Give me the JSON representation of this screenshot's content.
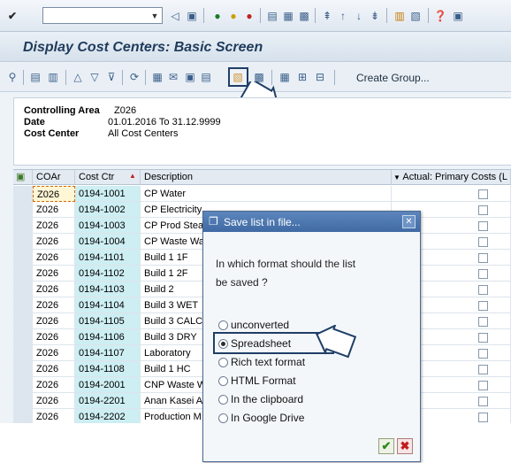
{
  "title": "Display Cost Centers: Basic Screen",
  "toolbar": {
    "command_value": "",
    "icons": [
      "check-icon",
      "back-icon",
      "save-icon",
      "back-nav-icon",
      "exit-icon",
      "cancel-icon",
      "print-icon",
      "find-icon",
      "find-next-icon",
      "first-page-icon",
      "prev-page-icon",
      "next-page-icon",
      "last-page-icon",
      "layout-icon",
      "config-icon",
      "help-icon",
      "settings-icon"
    ]
  },
  "app_toolbar": {
    "create_group_label": "Create Group..."
  },
  "header": {
    "controlling_area_label": "Controlling Area",
    "controlling_area_value": "Z026",
    "date_label": "Date",
    "date_value": "01.01.2016 To 31.12.9999",
    "cost_center_label": "Cost Center",
    "cost_center_value": "All Cost Centers"
  },
  "grid": {
    "columns": [
      "COAr",
      "Cost Ctr",
      "Description",
      "Actual: Primary Costs (L"
    ],
    "rows": [
      {
        "coar": "Z026",
        "cc": "0194-1001",
        "desc": "CP Water"
      },
      {
        "coar": "Z026",
        "cc": "0194-1002",
        "desc": "CP Electricity"
      },
      {
        "coar": "Z026",
        "cc": "0194-1003",
        "desc": "CP Prod Stea"
      },
      {
        "coar": "Z026",
        "cc": "0194-1004",
        "desc": "CP Waste Wa"
      },
      {
        "coar": "Z026",
        "cc": "0194-1101",
        "desc": "Build 1 1F"
      },
      {
        "coar": "Z026",
        "cc": "0194-1102",
        "desc": "Build 1 2F"
      },
      {
        "coar": "Z026",
        "cc": "0194-1103",
        "desc": "Build 2"
      },
      {
        "coar": "Z026",
        "cc": "0194-1104",
        "desc": "Build 3 WET"
      },
      {
        "coar": "Z026",
        "cc": "0194-1105",
        "desc": "Build 3 CALCI"
      },
      {
        "coar": "Z026",
        "cc": "0194-1106",
        "desc": "Build 3 DRY"
      },
      {
        "coar": "Z026",
        "cc": "0194-1107",
        "desc": "Laboratory"
      },
      {
        "coar": "Z026",
        "cc": "0194-1108",
        "desc": "Build 1 HC"
      },
      {
        "coar": "Z026",
        "cc": "0194-2001",
        "desc": "CNP Waste W"
      },
      {
        "coar": "Z026",
        "cc": "0194-2201",
        "desc": "Anan Kasei A"
      },
      {
        "coar": "Z026",
        "cc": "0194-2202",
        "desc": "Production M"
      }
    ]
  },
  "dialog": {
    "title": "Save list in file...",
    "question_line1": "In which format should the list",
    "question_line2": "be saved ?",
    "options": [
      {
        "label": "unconverted",
        "selected": false
      },
      {
        "label": "Spreadsheet",
        "selected": true
      },
      {
        "label": "Rich text format",
        "selected": false
      },
      {
        "label": "HTML Format",
        "selected": false
      },
      {
        "label": "In the clipboard",
        "selected": false
      },
      {
        "label": "In Google Drive",
        "selected": false
      }
    ]
  }
}
